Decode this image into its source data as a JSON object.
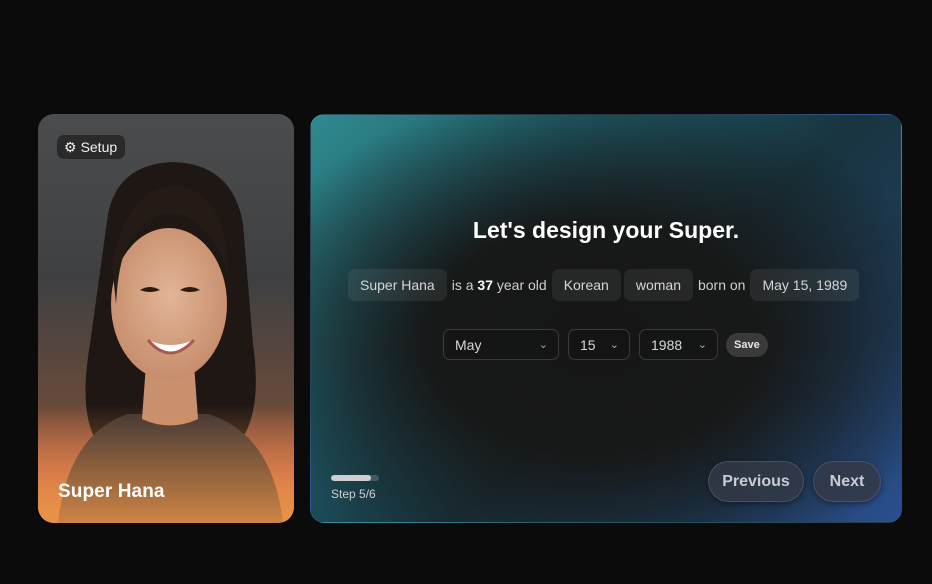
{
  "profile_card": {
    "setup_label": "Setup",
    "name": "Super Hana"
  },
  "main": {
    "headline": "Let's design your Super.",
    "sentence": {
      "name_value": "Super Hana",
      "text_is_a": "is a",
      "age": "37",
      "text_year_old": "year old",
      "nationality": "Korean",
      "gender": "woman",
      "text_born_on": "born on",
      "birthdate": "May 15, 1989"
    },
    "date_selector": {
      "month": "May",
      "day": "15",
      "year": "1988",
      "save_label": "Save"
    },
    "progress": {
      "step_label": "Step 5/6",
      "fraction": 0.833
    },
    "nav": {
      "previous_label": "Previous",
      "next_label": "Next"
    }
  },
  "colors": {
    "page_background": "#0b0b0b",
    "panel_teal": "#2f8a8e",
    "panel_blue": "#2a4f8e",
    "card_orange": "#e89248"
  },
  "icons": {
    "setup": "gear-icon",
    "dropdown": "chevron-down-icon"
  }
}
